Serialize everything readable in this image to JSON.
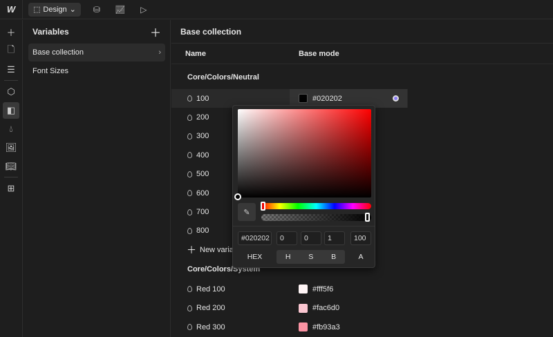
{
  "topbar": {
    "logo": "W",
    "mode": "Design",
    "icons": [
      "database-icon",
      "chart-icon",
      "play-icon"
    ]
  },
  "rail": {
    "icons": [
      "plus-icon",
      "page-icon",
      "navigator-icon",
      "component-icon",
      "variables-icon",
      "styles-icon",
      "assets-icon",
      "library-icon",
      "apps-icon"
    ]
  },
  "variables": {
    "title": "Variables",
    "collections": [
      {
        "label": "Base collection"
      },
      {
        "label": "Font Sizes"
      }
    ]
  },
  "main": {
    "title": "Base collection",
    "col_name": "Name",
    "col_mode": "Base mode",
    "section1": "Core/Colors/Neutral",
    "neutral": [
      {
        "name": "100",
        "value": "#020202",
        "color": "#020202"
      },
      {
        "name": "200"
      },
      {
        "name": "300"
      },
      {
        "name": "400"
      },
      {
        "name": "500"
      },
      {
        "name": "600"
      },
      {
        "name": "700"
      },
      {
        "name": "800"
      }
    ],
    "new_variable": "New variable",
    "section2": "Core/Colors/System",
    "reds": [
      {
        "name": "Red 100",
        "value": "#fff5f6",
        "color": "#fff5f6"
      },
      {
        "name": "Red 200",
        "value": "#fac6d0",
        "color": "#fac6d0"
      },
      {
        "name": "Red 300",
        "value": "#fb93a3",
        "color": "#fb93a3"
      }
    ]
  },
  "picker": {
    "hex": "#020202",
    "h": "0",
    "s": "0",
    "b": "1",
    "a": "100",
    "labels": {
      "hex": "HEX",
      "h": "H",
      "s": "S",
      "b": "B",
      "a": "A"
    }
  }
}
